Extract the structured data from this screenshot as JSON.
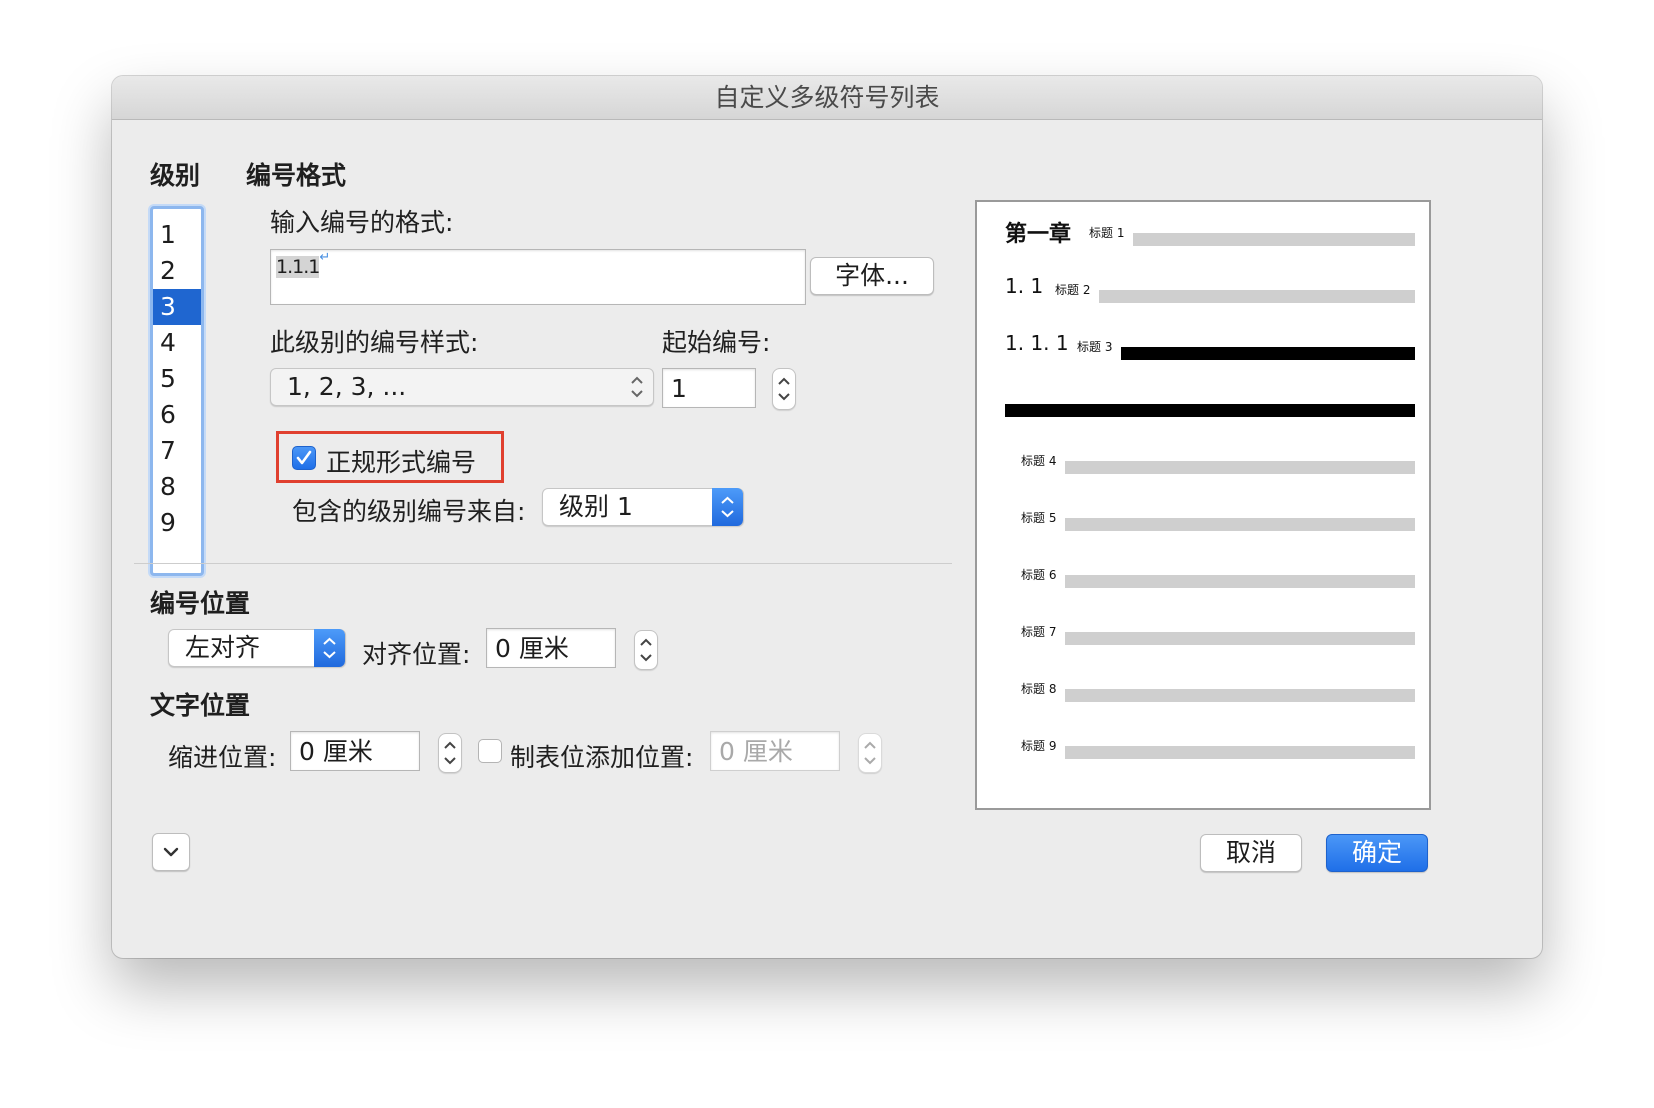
{
  "dialog": {
    "title": "自定义多级符号列表"
  },
  "levels": {
    "header": "级别",
    "items": [
      "1",
      "2",
      "3",
      "4",
      "5",
      "6",
      "7",
      "8",
      "9"
    ],
    "selected": "3"
  },
  "format": {
    "header": "编号格式",
    "enter_label": "输入编号的格式:",
    "format_value": "1.1.1",
    "font_button": "字体...",
    "style_label": "此级别的编号样式:",
    "style_value": "1, 2, 3, ...",
    "start_label": "起始编号:",
    "start_value": "1",
    "legal_label": "正规形式编号",
    "legal_checked": true,
    "include_label": "包含的级别编号来自:",
    "include_value": "级别 1"
  },
  "position": {
    "header": "编号位置",
    "align_value": "左对齐",
    "align_at_label": "对齐位置:",
    "align_at_value": "0 厘米"
  },
  "text_position": {
    "header": "文字位置",
    "indent_label": "缩进位置:",
    "indent_value": "0 厘米",
    "tab_label": "制表位添加位置:",
    "tab_checked": false,
    "tab_value": "0 厘米"
  },
  "preview": {
    "rows": [
      {
        "num": "第一章",
        "label": "标题 1"
      },
      {
        "num": "1. 1",
        "label": "标题 2"
      },
      {
        "num": "1. 1. 1",
        "label": "标题 3"
      },
      {
        "num": "",
        "label": "标题 4"
      },
      {
        "num": "",
        "label": "标题 5"
      },
      {
        "num": "",
        "label": "标题 6"
      },
      {
        "num": "",
        "label": "标题 7"
      },
      {
        "num": "",
        "label": "标题 8"
      },
      {
        "num": "",
        "label": "标题 9"
      }
    ]
  },
  "buttons": {
    "cancel": "取消",
    "ok": "确定"
  },
  "colors": {
    "accent": "#1f66d0",
    "highlight_box": "#e0402f"
  },
  "icons": {
    "expand": "chevron-down-icon",
    "check": "checkmark-icon",
    "stepper": "up-down-arrows-icon"
  }
}
